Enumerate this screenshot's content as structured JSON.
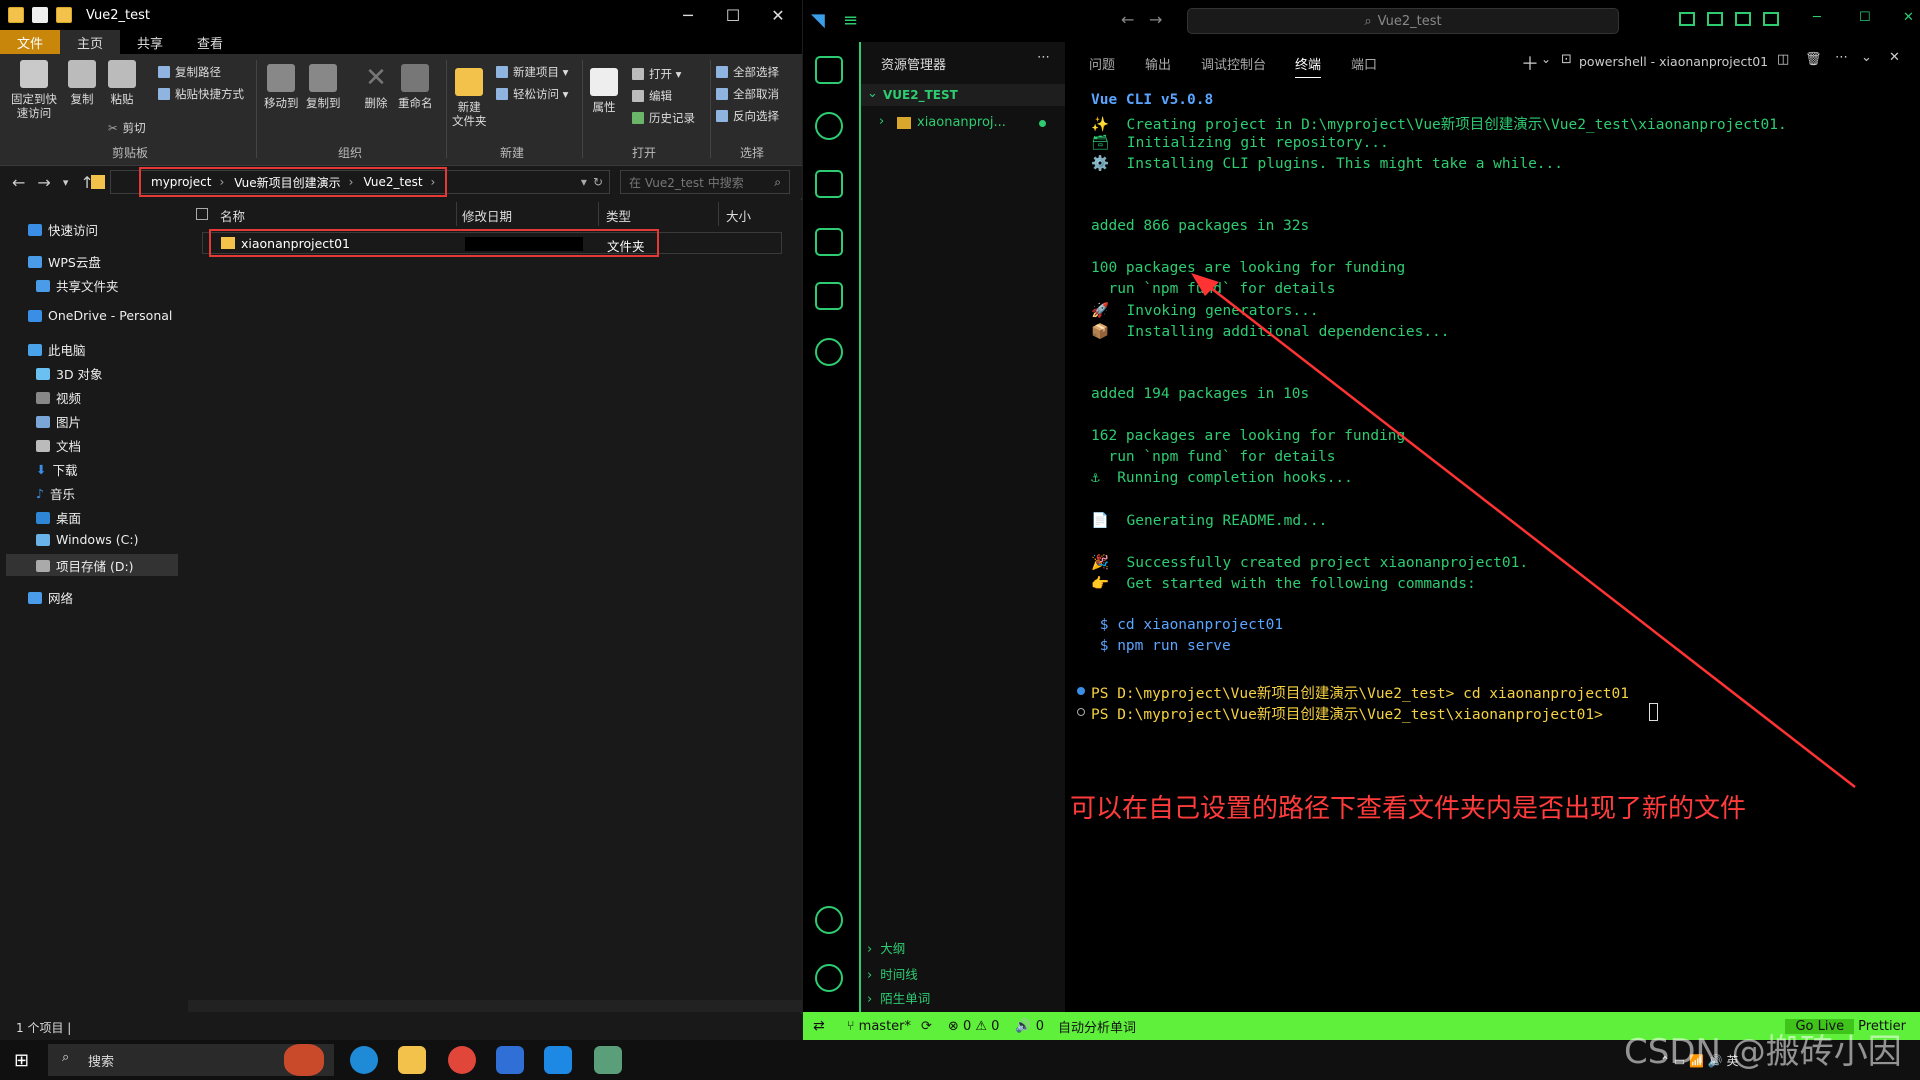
{
  "explorer": {
    "window_title": "Vue2_test",
    "ribbon_tabs": [
      "文件",
      "主页",
      "共享",
      "查看"
    ],
    "clipboard": {
      "pin": "固定到快\n速访问",
      "copy": "复制",
      "paste": "粘贴",
      "copy_path": "复制路径",
      "paste_shortcut": "粘贴快捷方式",
      "cut": "剪切",
      "group": "剪贴板"
    },
    "organize": {
      "move_to": "移动到",
      "copy_to": "复制到",
      "delete": "删除",
      "rename": "重命名",
      "group": "组织"
    },
    "new": {
      "new_item": "新建项目 ▾",
      "easy_access": "轻松访问 ▾",
      "new_folder": "新建\n文件夹",
      "group": "新建"
    },
    "open": {
      "properties": "属性",
      "open": "打开 ▾",
      "edit": "编辑",
      "history": "历史记录",
      "group": "打开"
    },
    "select": {
      "select_all": "全部选择",
      "select_none": "全部取消",
      "invert": "反向选择",
      "group": "选择"
    },
    "breadcrumb": [
      "myproject",
      "Vue新项目创建演示",
      "Vue2_test"
    ],
    "search_placeholder": "在 Vue2_test 中搜索",
    "nav_items": [
      "快速访问",
      "WPS云盘",
      "共享文件夹",
      "OneDrive - Personal",
      "此电脑",
      "3D 对象",
      "视频",
      "图片",
      "文档",
      "下载",
      "音乐",
      "桌面",
      "Windows (C:)",
      "项目存储 (D:)",
      "网络"
    ],
    "columns": [
      "名称",
      "修改日期",
      "类型",
      "大小"
    ],
    "rows": [
      {
        "name": "xiaonanproject01",
        "type": "文件夹"
      }
    ],
    "status": "1 个项目  |"
  },
  "vscode": {
    "command_center": "Vue2_test",
    "sidebar_title": "资源管理器",
    "workspace": "VUE2_TEST",
    "tree_item": "xiaonanproj...",
    "outline": "大纲",
    "timeline": "时间线",
    "stranger_words": "陌生单词",
    "panel_tabs": [
      "问题",
      "输出",
      "调试控制台",
      "终端",
      "端口"
    ],
    "terminal_name": "powershell - xiaonanproject01",
    "terminal_lines": [
      "Vue CLI v5.0.8",
      "✨  Creating project in D:\\myproject\\Vue新项目创建演示\\Vue2_test\\xiaonanproject01.",
      "🗃  Initializing git repository...",
      "⚙️  Installing CLI plugins. This might take a while...",
      "added 866 packages in 32s",
      "100 packages are looking for funding",
      "  run `npm fund` for details",
      "🚀  Invoking generators...",
      "📦  Installing additional dependencies...",
      "added 194 packages in 10s",
      "162 packages are looking for funding",
      "  run `npm fund` for details",
      "⚓  Running completion hooks...",
      "📄  Generating README.md...",
      "🎉  Successfully created project xiaonanproject01.",
      "👉  Get started with the following commands:",
      " $ cd xiaonanproject01",
      " $ npm run serve",
      "PS D:\\myproject\\Vue新项目创建演示\\Vue2_test> cd xiaonanproject01",
      "PS D:\\myproject\\Vue新项目创建演示\\Vue2_test\\xiaonanproject01> "
    ],
    "annotation": "可以在自己设置的路径下查看文件夹内是否出现了新的文件",
    "status": {
      "branch": "master*",
      "problems": "⊗ 0 ⚠ 0",
      "ports": "🔊 0",
      "auto": "自动分析单词",
      "golive": "Go Live",
      "prettier": "Prettier"
    }
  },
  "taskbar": {
    "search": "搜索"
  },
  "watermark": "CSDN @搬砖小因"
}
